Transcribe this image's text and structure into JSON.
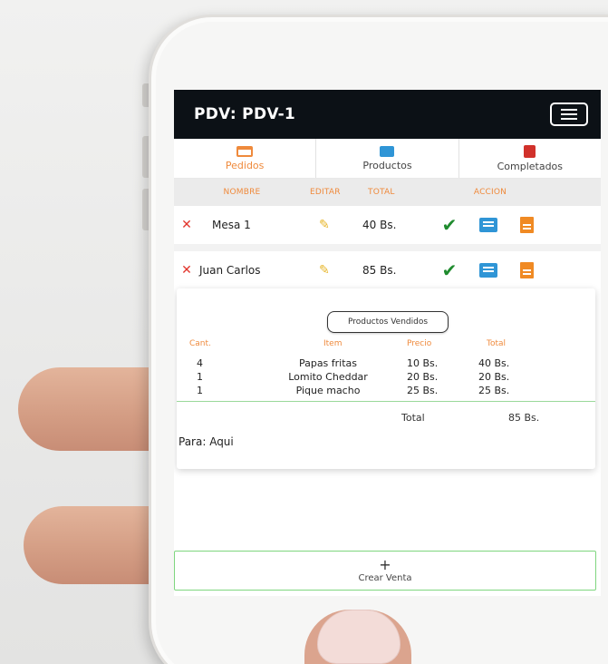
{
  "header": {
    "title": "PDV: PDV-1",
    "menu_icon": "hamburger-icon"
  },
  "tabs": [
    {
      "label": "Pedidos",
      "icon": "orders-icon",
      "active": true
    },
    {
      "label": "Productos",
      "icon": "products-icon",
      "active": false
    },
    {
      "label": "Completados",
      "icon": "completed-icon",
      "active": false
    }
  ],
  "table": {
    "headers": {
      "name": "NOMBRE",
      "edit": "EDITAR",
      "total": "TOTAL",
      "action": "ACCION"
    },
    "rows": [
      {
        "name": "Mesa 1",
        "total": "40 Bs."
      },
      {
        "name": "Juan Carlos",
        "total": "85 Bs."
      }
    ]
  },
  "detail": {
    "button_label": "Productos Vendidos",
    "headers": {
      "qty": "Cant.",
      "item": "Item",
      "price": "Precio",
      "total": "Total"
    },
    "items": [
      {
        "qty": "4",
        "item": "Papas fritas",
        "price": "10 Bs.",
        "total": "40 Bs."
      },
      {
        "qty": "1",
        "item": "Lomito Cheddar",
        "price": "20 Bs.",
        "total": "20 Bs."
      },
      {
        "qty": "1",
        "item": "Pique macho",
        "price": "25 Bs.",
        "total": "25 Bs."
      }
    ],
    "sum_label": "Total",
    "sum_value": "85 Bs.",
    "note": "Para: Aqui"
  },
  "new_sale": {
    "label": "Crear Venta",
    "icon": "+"
  },
  "colors": {
    "accent": "#ef8a3c",
    "header_bg": "#0c1116",
    "delete": "#e2352c",
    "check": "#1f8b2e",
    "list": "#2f95d6"
  }
}
